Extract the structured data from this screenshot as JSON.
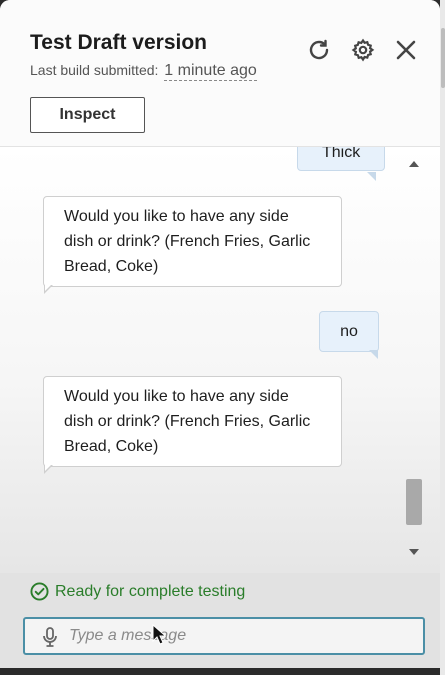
{
  "header": {
    "title": "Test Draft version",
    "subtitle_prefix": "Last build submitted:",
    "subtitle_time": "1 minute ago",
    "inspect_label": "Inspect",
    "icons": [
      "refresh-icon",
      "settings-icon",
      "close-icon"
    ]
  },
  "chat": {
    "messages": [
      {
        "role": "user",
        "text": "Thick"
      },
      {
        "role": "bot",
        "text": "Would you like to have any side dish or drink? (French Fries, Garlic Bread, Coke)"
      },
      {
        "role": "user",
        "text": "no"
      },
      {
        "role": "bot",
        "text": "Would you like to have any side dish or drink? (French Fries, Garlic Bread, Coke)"
      }
    ]
  },
  "footer": {
    "status_text": "Ready for complete testing",
    "input_placeholder": "Type a message",
    "input_value": ""
  },
  "colors": {
    "status_green": "#2a7d2a",
    "input_border": "#4b8fa6",
    "user_bubble": "#e7f1fb"
  }
}
